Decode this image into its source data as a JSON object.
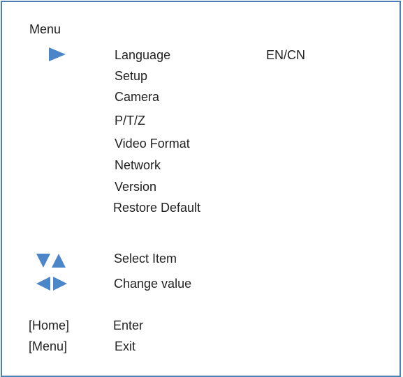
{
  "menu": {
    "title": "Menu",
    "selected_index": 0,
    "items": [
      {
        "label": "Language",
        "value": "EN/CN"
      },
      {
        "label": "Setup"
      },
      {
        "label": "Camera"
      },
      {
        "label": "P/T/Z"
      },
      {
        "label": "Video Format"
      },
      {
        "label": "Network"
      },
      {
        "label": "Version"
      },
      {
        "label": "Restore Default"
      }
    ]
  },
  "legend": {
    "select_item": "Select Item",
    "change_value": "Change value"
  },
  "keys": [
    {
      "key": "[Home]",
      "action": "Enter"
    },
    {
      "key": "[Menu]",
      "action": "Exit"
    }
  ],
  "colors": {
    "accent": "#4a86c8",
    "border": "#4a7fb8",
    "text": "#222222"
  },
  "icons": {
    "selection": "triangle-right-icon",
    "select_item": "triangle-down-up-icon",
    "change_value": "triangle-left-right-icon"
  }
}
